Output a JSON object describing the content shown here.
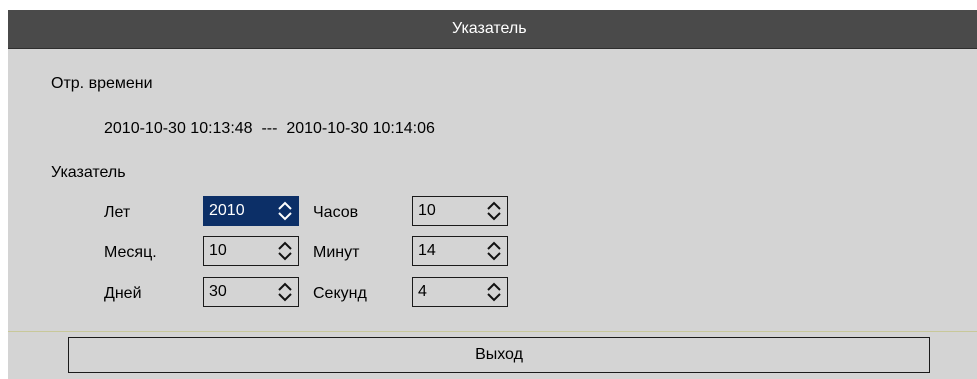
{
  "dialog": {
    "title": "Указатель"
  },
  "time_range": {
    "label": "Отр. времени",
    "value": "2010-10-30 10:13:48  ---  2010-10-30 10:14:06"
  },
  "pointer": {
    "label": "Указатель",
    "fields": {
      "year": {
        "label": "Лет",
        "value": "2010"
      },
      "month": {
        "label": "Месяц.",
        "value": "10"
      },
      "day": {
        "label": "Дней",
        "value": "30"
      },
      "hour": {
        "label": "Часов",
        "value": "10"
      },
      "minute": {
        "label": "Минут",
        "value": "14"
      },
      "second": {
        "label": "Секунд",
        "value": "4"
      }
    }
  },
  "buttons": {
    "exit_label": "Выход"
  },
  "colors": {
    "titlebar": "#4a4a4a",
    "panel": "#d4d4d4",
    "focus": "#0c2f67"
  }
}
